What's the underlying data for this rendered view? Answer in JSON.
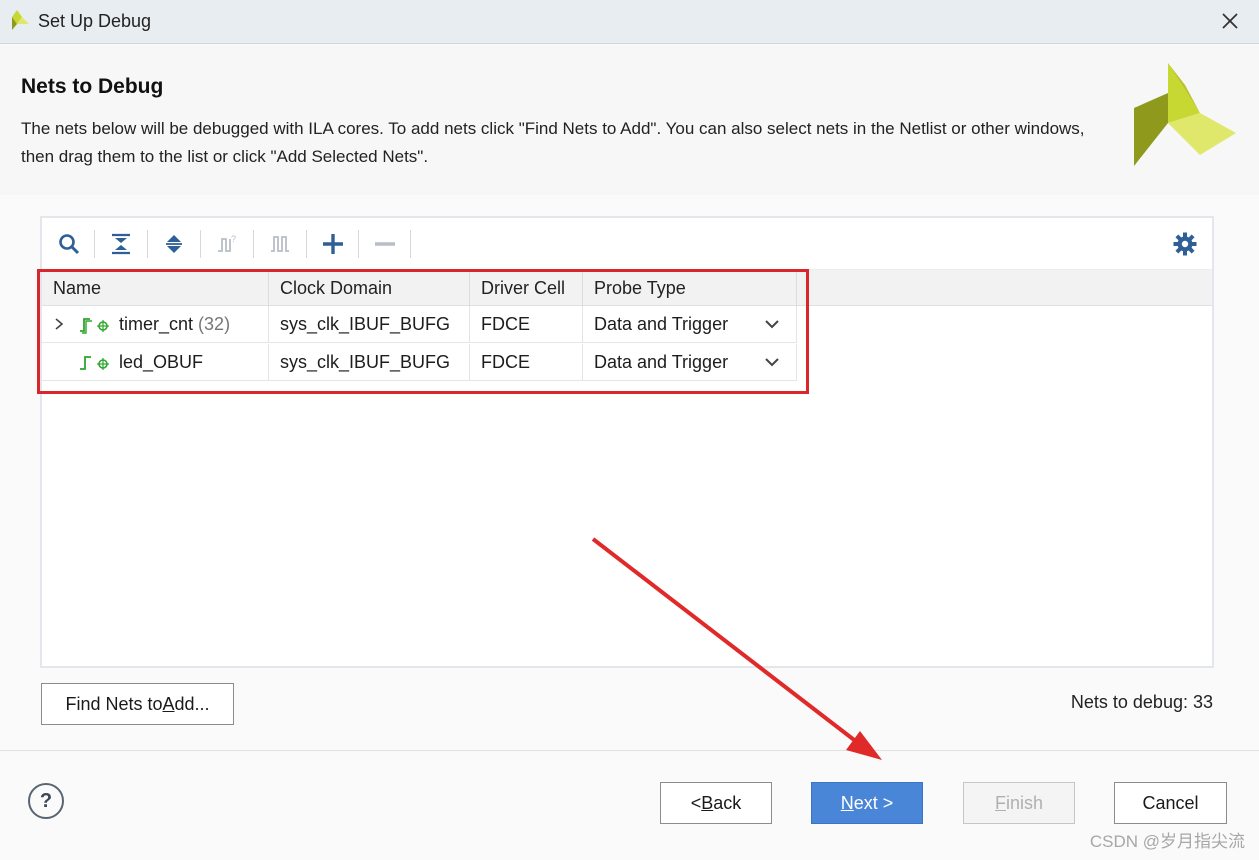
{
  "window": {
    "title": "Set Up Debug"
  },
  "header": {
    "title": "Nets to Debug",
    "description": "The nets below will be debugged with ILA cores. To add nets click \"Find Nets to Add\". You can also select nets in the Netlist or other windows, then drag them to the list or click \"Add Selected Nets\"."
  },
  "toolbar": {
    "icons": [
      "search-icon",
      "collapse-all-icon",
      "expand-all-icon",
      "waveform-icon",
      "pulse-icon",
      "add-icon",
      "remove-icon",
      "gear-icon"
    ]
  },
  "table": {
    "columns": [
      "Name",
      "Clock Domain",
      "Driver Cell",
      "Probe Type"
    ],
    "rows": [
      {
        "name": "timer_cnt",
        "count": "(32)",
        "clock_domain": "sys_clk_IBUF_BUFG",
        "driver_cell": "FDCE",
        "probe_type": "Data and Trigger"
      },
      {
        "name": "led_OBUF",
        "count": "",
        "clock_domain": "sys_clk_IBUF_BUFG",
        "driver_cell": "FDCE",
        "probe_type": "Data and Trigger"
      }
    ]
  },
  "find_nets": {
    "prefix": "Find Nets to ",
    "mnemonic": "A",
    "suffix": "dd..."
  },
  "status": {
    "nets_to_debug": "Nets to debug: 33"
  },
  "buttons": {
    "back": {
      "prefix": "< ",
      "mnemonic": "B",
      "suffix": "ack"
    },
    "next": {
      "mnemonic": "N",
      "suffix": "ext >"
    },
    "finish": {
      "mnemonic": "F",
      "suffix": "inish"
    },
    "cancel": "Cancel",
    "help": "?"
  },
  "watermark": "CSDN @岁月指尖流",
  "colors": {
    "accent": "#4a86d8",
    "highlight": "#d9262c",
    "net_icon": "#2fa52f",
    "logo": "#c8d832"
  }
}
